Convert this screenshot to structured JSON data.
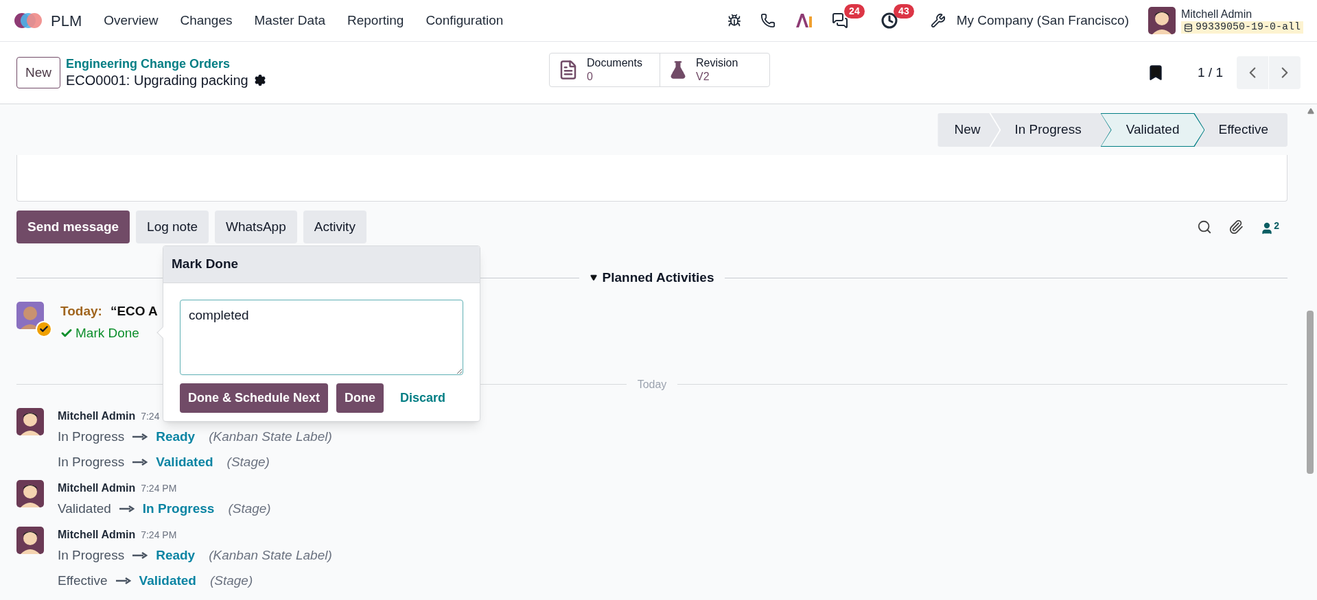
{
  "navbar": {
    "app_name": "PLM",
    "menu": [
      "Overview",
      "Changes",
      "Master Data",
      "Reporting",
      "Configuration"
    ],
    "messages_count": "24",
    "activities_count": "43",
    "company": "My Company (San Francisco)",
    "user": {
      "name": "Mitchell Admin",
      "database": "99339050-19-0-all"
    }
  },
  "control_panel": {
    "new_button": "New",
    "breadcrumb": "Engineering Change Orders",
    "record_title": "ECO0001: Upgrading packing",
    "smart_buttons": [
      {
        "kind": "document",
        "label": "Documents",
        "value": "0"
      },
      {
        "kind": "flask",
        "label": "Revision",
        "value": "V2"
      }
    ],
    "pager": "1 / 1"
  },
  "statusbar": [
    {
      "label": "New",
      "selected": false
    },
    {
      "label": "In Progress",
      "selected": false
    },
    {
      "label": "Validated",
      "selected": true
    },
    {
      "label": "Effective",
      "selected": false
    }
  ],
  "chatter": {
    "buttons": [
      {
        "label": "Send message",
        "selected": true
      },
      {
        "label": "Log note",
        "selected": false
      },
      {
        "label": "WhatsApp",
        "selected": false
      },
      {
        "label": "Activity",
        "selected": false
      }
    ],
    "followers_count": "2",
    "planned_activities_label": "Planned Activities",
    "activity": {
      "due": "Today:",
      "summary": "“ECO A",
      "mark_done": "Mark Done"
    },
    "date_separator": "Today",
    "messages": [
      {
        "author": "Mitchell Admin",
        "time": "7:24",
        "changes": [
          {
            "old": "In Progress",
            "new": "Ready",
            "field": "(Kanban State Label)"
          },
          {
            "old": "In Progress",
            "new": "Validated",
            "field": "(Stage)"
          }
        ]
      },
      {
        "author": "Mitchell Admin",
        "time": "7:24 PM",
        "changes": [
          {
            "old": "Validated",
            "new": "In Progress",
            "field": "(Stage)"
          }
        ]
      },
      {
        "author": "Mitchell Admin",
        "time": "7:24 PM",
        "changes": [
          {
            "old": "In Progress",
            "new": "Ready",
            "field": "(Kanban State Label)"
          },
          {
            "old": "Effective",
            "new": "Validated",
            "field": "(Stage)"
          }
        ]
      }
    ]
  },
  "popover": {
    "title": "Mark Done",
    "feedback": "completed",
    "buttons": [
      "Done & Schedule Next",
      "Done"
    ],
    "discard": "Discard"
  }
}
